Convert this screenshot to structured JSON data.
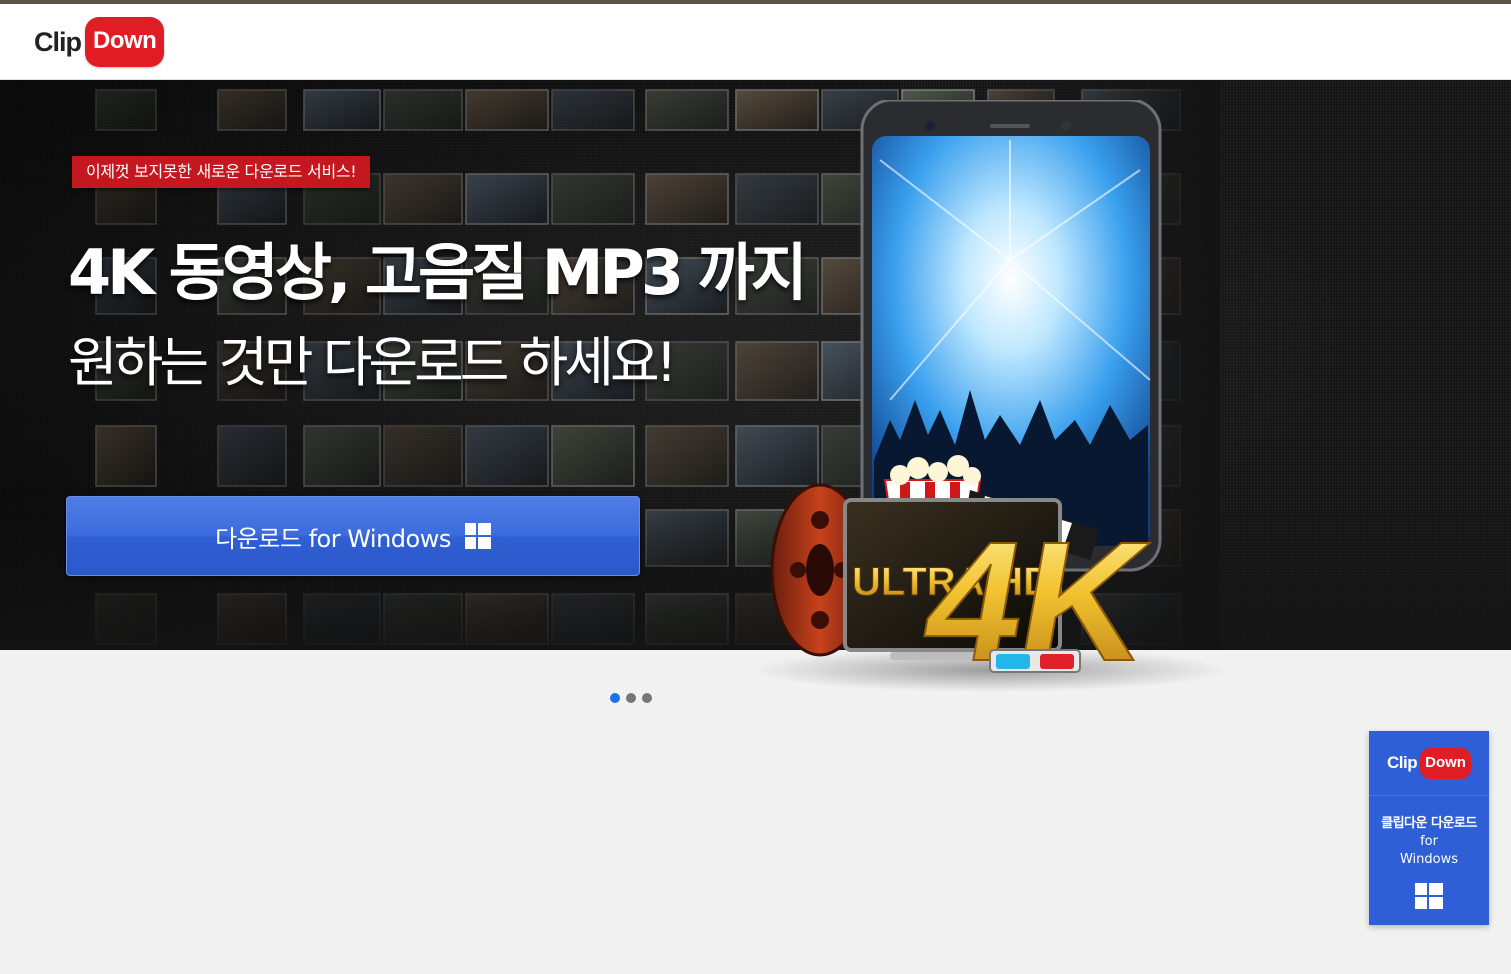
{
  "header": {
    "logo": {
      "clip": "Clip",
      "down": "Down"
    }
  },
  "hero": {
    "badge": "이제껏 보지못한 새로운 다운로드 서비스!",
    "headline_line1": "4K 동영상, 고음질 MP3 까지",
    "headline_line2": "원하는 것만 다운로드 하세요!",
    "download_button": {
      "label": "다운로드 for Windows",
      "icon": "windows-icon"
    },
    "graphic_text": {
      "ultra_hd": "ULTRA HD",
      "badge_4k": "4K"
    }
  },
  "carousel": {
    "total": 3,
    "active": 1
  },
  "side_widget": {
    "logo": {
      "clip": "Clip",
      "down": "Down"
    },
    "line1": "클립다운 다운로드",
    "line2": "for",
    "line3": "Windows",
    "icon": "windows-icon"
  },
  "colors": {
    "accent_blue": "#2f5fd6",
    "brand_red": "#e01d24",
    "dot_active": "#1a73e8"
  }
}
